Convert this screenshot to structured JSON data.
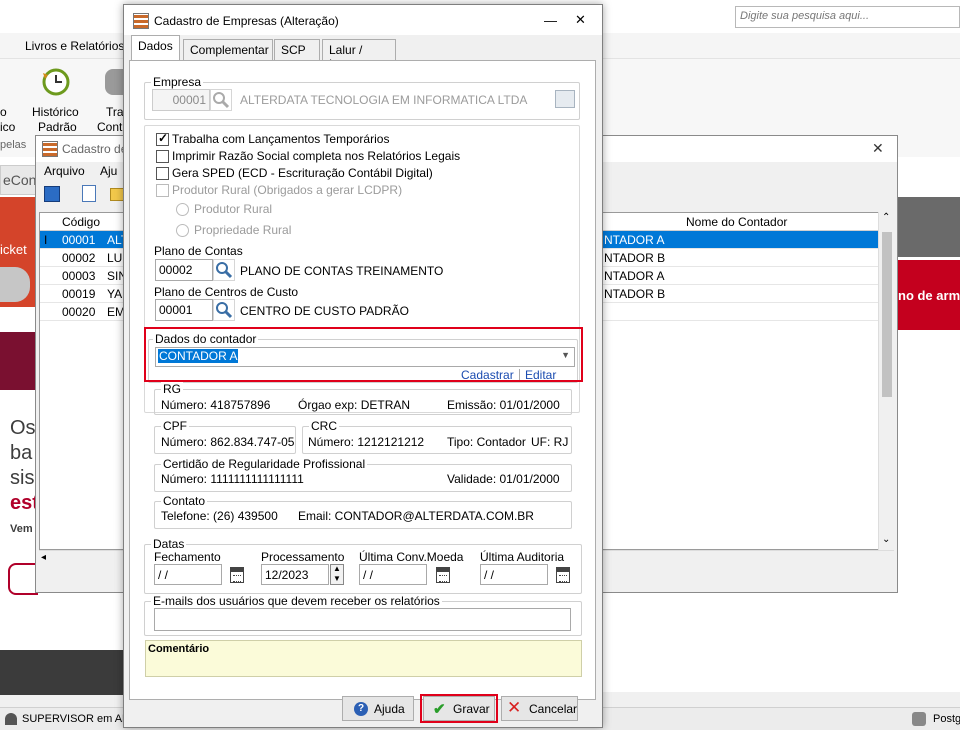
{
  "background": {
    "search_placeholder": "Digite sua pesquisa aqui...",
    "menu_item": "Livros e Relatórios",
    "ribbon_historico": [
      "Histórico",
      "Padrão"
    ],
    "ribbon_partial_left": [
      "o",
      "ico"
    ],
    "ribbon_partial_tra": [
      "Tra",
      "Cont"
    ],
    "ribbon_group_partial": "pelas",
    "panel_tab_partial": "eCont",
    "ticket_partial": "icket",
    "promo_lines": [
      "Os",
      "ba",
      "sis",
      "est",
      "Vem"
    ],
    "right_banner_partial": "no de arm",
    "status_user": "SUPERVISOR em ALTI",
    "status_db": "Postg"
  },
  "window2": {
    "title": "Cadastro de",
    "menu": [
      "Arquivo",
      "Aju"
    ],
    "col_codigo": "Código",
    "col_contador": "Nome do Contador",
    "rows": [
      {
        "codigo": "00001",
        "nome": "ALT",
        "contador": "NTADOR A"
      },
      {
        "codigo": "00002",
        "nome": "LU",
        "contador": "NTADOR B"
      },
      {
        "codigo": "00003",
        "nome": "SIN",
        "contador": "NTADOR A"
      },
      {
        "codigo": "00019",
        "nome": "YA",
        "contador": "NTADOR B"
      },
      {
        "codigo": "00020",
        "nome": "EM",
        "contador": ""
      }
    ]
  },
  "dialog": {
    "title": "Cadastro de Empresas (Alteração)",
    "tabs": [
      "Dados",
      "Complementar",
      "SCP",
      "Lalur / Lacs"
    ],
    "empresa": {
      "group": "Empresa",
      "code": "00001",
      "name": "ALTERDATA TECNOLOGIA EM INFORMATICA LTDA"
    },
    "options": {
      "trabalha": "Trabalha com Lançamentos Temporários",
      "imprimir": "Imprimir Razão Social completa nos Relatórios Legais",
      "sped": "Gera SPED (ECD - Escrituração Contábil Digital)",
      "produtor": "Produtor Rural  (Obrigados a gerar LCDPR)",
      "radio_produtor": "Produtor Rural",
      "radio_propriedade": "Propriedade Rural"
    },
    "plano_contas": {
      "label": "Plano de Contas",
      "code": "00002",
      "name": "PLANO DE CONTAS TREINAMENTO"
    },
    "plano_custos": {
      "label": "Plano de Centros de Custo",
      "code": "00001",
      "name": "CENTRO DE CUSTO PADRÃO"
    },
    "contador": {
      "group": "Dados do contador",
      "selected": "CONTADOR A",
      "cadastrar": "Cadastrar",
      "editar": "Editar"
    },
    "rg": {
      "group": "RG",
      "numero": "Número: 418757896",
      "orgao": "Órgao exp: DETRAN",
      "emissao": "Emissão: 01/01/2000"
    },
    "cpf": {
      "group": "CPF",
      "numero": "Número: 862.834.747-05"
    },
    "crc": {
      "group": "CRC",
      "numero": "Número: 1212121212",
      "tipo": "Tipo: Contador",
      "uf": "UF: RJ"
    },
    "certidao": {
      "group": "Certidão de Regularidade Profissional",
      "numero": "Número: 1111111111111111",
      "validade": "Validade: 01/01/2000"
    },
    "contato": {
      "group": "Contato",
      "telefone": "Telefone: (26) 439500",
      "email": "Email: CONTADOR@ALTERDATA.COM.BR"
    },
    "datas": {
      "group": "Datas",
      "fechamento": "Fechamento",
      "fechamento_val": " / /",
      "processamento": "Processamento",
      "processamento_val": "12/2023",
      "conv_moeda": "Última Conv.Moeda",
      "conv_moeda_val": " / /",
      "auditoria": "Última Auditoria",
      "auditoria_val": " / /"
    },
    "emails_label": "E-mails dos usuários que devem receber os relatórios",
    "comentario": "Comentário",
    "buttons": {
      "ajuda": "Ajuda",
      "gravar": "Gravar",
      "cancelar": "Cancelar"
    }
  },
  "colors": {
    "selection": "#0078d7",
    "highlight_box": "#e0001a",
    "comment_bg": "#fbfbd9",
    "link": "#1a4bb0"
  }
}
